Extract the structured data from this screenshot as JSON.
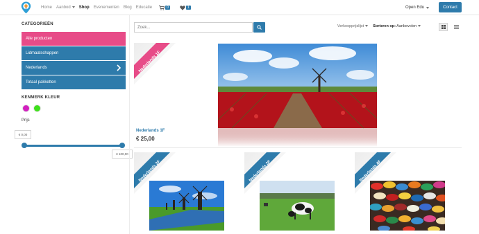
{
  "nav": {
    "items": [
      {
        "label": "Home",
        "active": false,
        "dropdown": false
      },
      {
        "label": "Aanbod",
        "active": false,
        "dropdown": true
      },
      {
        "label": "Shop",
        "active": true,
        "dropdown": false
      },
      {
        "label": "Evenementen",
        "active": false,
        "dropdown": false
      },
      {
        "label": "Blog",
        "active": false,
        "dropdown": false
      },
      {
        "label": "Educatie",
        "active": false,
        "dropdown": false
      }
    ],
    "cart_count": "0",
    "wishlist_count": "1",
    "user_label": "Open Edu",
    "contact_label": "Contact"
  },
  "sidebar": {
    "categories_heading": "CATEGORIEËN",
    "categories": [
      {
        "label": "Alle producten",
        "active": true,
        "has_children": false
      },
      {
        "label": "Lidmaatschappen",
        "active": false,
        "has_children": false
      },
      {
        "label": "Nederlands",
        "active": false,
        "has_children": true
      },
      {
        "label": "Totaal pakketten",
        "active": false,
        "has_children": false
      }
    ],
    "color_heading": "KENMERK KLEUR",
    "colors": [
      "#d21fbf",
      "#3ee01b"
    ],
    "price_heading": "Prijs",
    "price_min": "€ 0,00",
    "price_max": "€ 100,00"
  },
  "main": {
    "search_placeholder": "Zoek...",
    "pricelist_label": "Verkoopprijslijst",
    "sort_prefix": "Sorteren op:",
    "sort_value": "Aanbevolen",
    "accent": "#2e7bab",
    "ribbon_pink": "#e74c88",
    "products": [
      {
        "ribbon": "Nederlands 1F",
        "name": "Nederlands 1F",
        "price": "€ 25,00"
      },
      {
        "ribbon": "Nederlands 2F"
      },
      {
        "ribbon": "Nederlands 3F"
      },
      {
        "ribbon": "Nederlands 4F"
      }
    ]
  }
}
